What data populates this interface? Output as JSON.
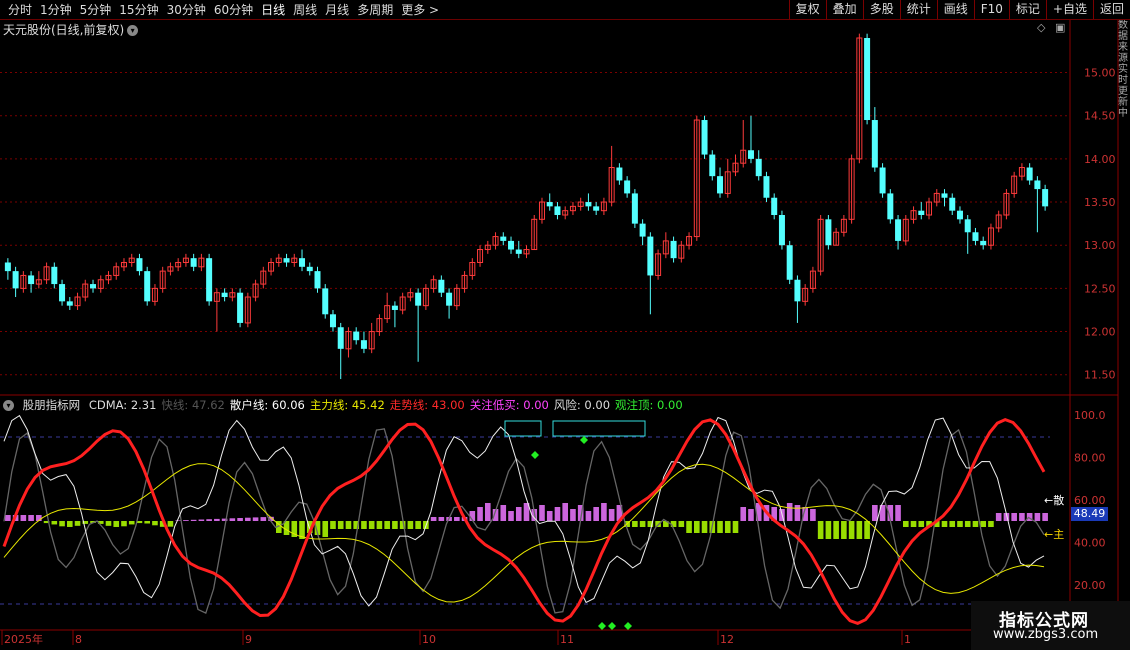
{
  "toolbar": {
    "periods": [
      "分时",
      "1分钟",
      "5分钟",
      "15分钟",
      "30分钟",
      "60分钟",
      "日线",
      "周线",
      "月线",
      "多周期",
      "更多 >"
    ],
    "active": "日线",
    "right": [
      "复权",
      "叠加",
      "多股",
      "统计",
      "画线",
      "F10",
      "标记",
      "+自选",
      "返回"
    ]
  },
  "chart_title": "天元股份(日线,前复权)",
  "chart_ctrl_icons": [
    "diamond-icon",
    "window-icon"
  ],
  "price_axis": {
    "ticks": [
      "15.00",
      "14.50",
      "14.00",
      "13.50",
      "13.00",
      "12.50",
      "12.00",
      "11.50"
    ]
  },
  "indicator": {
    "name": "股朋指标网",
    "items": [
      {
        "label": "CDMA: 2.31",
        "color": "#dddddd"
      },
      {
        "label": "快线: 47.62",
        "color": "#555555"
      },
      {
        "label": "散户线: 60.06",
        "color": "#ffffff"
      },
      {
        "label": "主力线: 45.42",
        "color": "#e8e800"
      },
      {
        "label": "走势线: 43.00",
        "color": "#ff2a2a"
      },
      {
        "label": "关注低买: 0.00",
        "color": "#ff44ff"
      },
      {
        "label": "风险: 0.00",
        "color": "#dddddd"
      },
      {
        "label": "观注顶: 0.00",
        "color": "#33ee33"
      }
    ],
    "ticks": [
      "100.0",
      "80.00",
      "60.00",
      "40.00",
      "20.00"
    ],
    "current_value": "48.49",
    "side_labels": [
      "←散",
      "←主"
    ]
  },
  "time_axis": {
    "labels": [
      "2025年",
      "8",
      "9",
      "10",
      "11",
      "12",
      "1"
    ]
  },
  "watermark": {
    "line1": "指标公式网",
    "line2": "www.zbgs3.com"
  },
  "right_strip": "数据来源实时更新中",
  "colors": {
    "up": "#ff3b3b",
    "down": "#54ffff",
    "grid": "#7a0000",
    "background": "#000000"
  },
  "chart_data": {
    "type": "candlestick",
    "ylim": [
      11.3,
      15.4
    ],
    "candles": [
      [
        12.8,
        12.7,
        12.85,
        12.6
      ],
      [
        12.7,
        12.5,
        12.75,
        12.4
      ],
      [
        12.5,
        12.65,
        12.7,
        12.45
      ],
      [
        12.65,
        12.55,
        12.7,
        12.45
      ],
      [
        12.55,
        12.6,
        12.7,
        12.5
      ],
      [
        12.6,
        12.75,
        12.8,
        12.55
      ],
      [
        12.75,
        12.55,
        12.8,
        12.5
      ],
      [
        12.55,
        12.35,
        12.6,
        12.3
      ],
      [
        12.35,
        12.3,
        12.4,
        12.25
      ],
      [
        12.3,
        12.4,
        12.45,
        12.25
      ],
      [
        12.4,
        12.55,
        12.6,
        12.35
      ],
      [
        12.55,
        12.5,
        12.6,
        12.45
      ],
      [
        12.5,
        12.6,
        12.65,
        12.45
      ],
      [
        12.6,
        12.65,
        12.7,
        12.55
      ],
      [
        12.65,
        12.75,
        12.8,
        12.6
      ],
      [
        12.75,
        12.8,
        12.85,
        12.7
      ],
      [
        12.8,
        12.85,
        12.9,
        12.75
      ],
      [
        12.85,
        12.7,
        12.9,
        12.65
      ],
      [
        12.7,
        12.35,
        12.75,
        12.3
      ],
      [
        12.35,
        12.5,
        12.55,
        12.3
      ],
      [
        12.5,
        12.7,
        12.75,
        12.45
      ],
      [
        12.7,
        12.75,
        12.8,
        12.65
      ],
      [
        12.75,
        12.8,
        12.85,
        12.7
      ],
      [
        12.8,
        12.85,
        12.9,
        12.75
      ],
      [
        12.85,
        12.75,
        12.9,
        12.7
      ],
      [
        12.75,
        12.85,
        12.9,
        12.7
      ],
      [
        12.85,
        12.35,
        12.9,
        12.3
      ],
      [
        12.35,
        12.45,
        12.5,
        12.0
      ],
      [
        12.45,
        12.4,
        12.5,
        12.35
      ],
      [
        12.4,
        12.45,
        12.5,
        12.35
      ],
      [
        12.45,
        12.1,
        12.5,
        12.05
      ],
      [
        12.1,
        12.4,
        12.45,
        12.05
      ],
      [
        12.4,
        12.55,
        12.6,
        12.35
      ],
      [
        12.55,
        12.7,
        12.75,
        12.5
      ],
      [
        12.7,
        12.8,
        12.85,
        12.65
      ],
      [
        12.8,
        12.85,
        12.9,
        12.75
      ],
      [
        12.85,
        12.8,
        12.9,
        12.75
      ],
      [
        12.8,
        12.85,
        12.9,
        12.75
      ],
      [
        12.85,
        12.75,
        12.95,
        12.7
      ],
      [
        12.75,
        12.7,
        12.8,
        12.65
      ],
      [
        12.7,
        12.5,
        12.75,
        12.45
      ],
      [
        12.5,
        12.2,
        12.55,
        12.15
      ],
      [
        12.2,
        12.05,
        12.25,
        12.0
      ],
      [
        12.05,
        11.8,
        12.1,
        11.45
      ],
      [
        11.8,
        12.0,
        12.05,
        11.7
      ],
      [
        12.0,
        11.9,
        12.05,
        11.85
      ],
      [
        11.9,
        11.8,
        12.0,
        11.75
      ],
      [
        11.8,
        12.0,
        12.1,
        11.75
      ],
      [
        12.0,
        12.15,
        12.2,
        11.95
      ],
      [
        12.15,
        12.3,
        12.45,
        12.1
      ],
      [
        12.3,
        12.25,
        12.35,
        12.05
      ],
      [
        12.25,
        12.4,
        12.45,
        12.2
      ],
      [
        12.4,
        12.45,
        12.5,
        12.35
      ],
      [
        12.45,
        12.3,
        12.5,
        11.65
      ],
      [
        12.3,
        12.5,
        12.55,
        12.25
      ],
      [
        12.5,
        12.6,
        12.65,
        12.45
      ],
      [
        12.6,
        12.45,
        12.65,
        12.4
      ],
      [
        12.45,
        12.3,
        12.5,
        12.15
      ],
      [
        12.3,
        12.5,
        12.55,
        12.25
      ],
      [
        12.5,
        12.65,
        12.7,
        12.45
      ],
      [
        12.65,
        12.8,
        12.85,
        12.6
      ],
      [
        12.8,
        12.95,
        13.0,
        12.75
      ],
      [
        12.95,
        13.0,
        13.05,
        12.9
      ],
      [
        13.0,
        13.1,
        13.15,
        12.95
      ],
      [
        13.1,
        13.05,
        13.15,
        13.0
      ],
      [
        13.05,
        12.95,
        13.1,
        12.9
      ],
      [
        12.95,
        12.9,
        13.05,
        12.85
      ],
      [
        12.9,
        12.95,
        13.0,
        12.85
      ],
      [
        12.95,
        13.3,
        13.35,
        12.95
      ],
      [
        13.3,
        13.5,
        13.55,
        13.25
      ],
      [
        13.5,
        13.45,
        13.6,
        13.4
      ],
      [
        13.45,
        13.35,
        13.5,
        13.3
      ],
      [
        13.35,
        13.4,
        13.45,
        13.3
      ],
      [
        13.4,
        13.45,
        13.5,
        13.35
      ],
      [
        13.45,
        13.5,
        13.55,
        13.4
      ],
      [
        13.5,
        13.45,
        13.6,
        13.4
      ],
      [
        13.45,
        13.4,
        13.5,
        13.35
      ],
      [
        13.4,
        13.5,
        13.55,
        13.35
      ],
      [
        13.5,
        13.9,
        14.15,
        13.45
      ],
      [
        13.9,
        13.75,
        13.95,
        13.7
      ],
      [
        13.75,
        13.6,
        13.8,
        13.55
      ],
      [
        13.6,
        13.25,
        13.65,
        13.2
      ],
      [
        13.25,
        13.1,
        13.3,
        13.0
      ],
      [
        13.1,
        12.65,
        13.15,
        12.2
      ],
      [
        12.65,
        12.9,
        12.95,
        12.6
      ],
      [
        12.9,
        13.05,
        13.15,
        12.85
      ],
      [
        13.05,
        12.85,
        13.1,
        12.8
      ],
      [
        12.85,
        13.0,
        13.05,
        12.8
      ],
      [
        13.0,
        13.1,
        13.15,
        12.95
      ],
      [
        13.1,
        14.45,
        14.5,
        13.05
      ],
      [
        14.45,
        14.05,
        14.5,
        14.0
      ],
      [
        14.05,
        13.8,
        14.1,
        13.75
      ],
      [
        13.8,
        13.6,
        13.9,
        13.55
      ],
      [
        13.6,
        13.85,
        14.0,
        13.55
      ],
      [
        13.85,
        13.95,
        14.05,
        13.8
      ],
      [
        13.95,
        14.1,
        14.45,
        13.9
      ],
      [
        14.1,
        14.0,
        14.5,
        13.95
      ],
      [
        14.0,
        13.8,
        14.1,
        13.75
      ],
      [
        13.8,
        13.55,
        13.85,
        13.5
      ],
      [
        13.55,
        13.35,
        13.6,
        13.3
      ],
      [
        13.35,
        13.0,
        13.4,
        12.95
      ],
      [
        13.0,
        12.6,
        13.05,
        12.55
      ],
      [
        12.6,
        12.35,
        12.65,
        12.1
      ],
      [
        12.35,
        12.5,
        12.55,
        12.3
      ],
      [
        12.5,
        12.7,
        12.75,
        12.45
      ],
      [
        12.7,
        13.3,
        13.35,
        12.65
      ],
      [
        13.3,
        13.0,
        13.35,
        12.95
      ],
      [
        13.0,
        13.15,
        13.2,
        13.0
      ],
      [
        13.15,
        13.3,
        13.35,
        13.1
      ],
      [
        13.3,
        14.0,
        14.05,
        13.25
      ],
      [
        14.0,
        15.4,
        15.45,
        13.95
      ],
      [
        15.4,
        14.45,
        15.45,
        14.4
      ],
      [
        14.45,
        13.9,
        14.6,
        13.85
      ],
      [
        13.9,
        13.6,
        13.95,
        13.55
      ],
      [
        13.6,
        13.3,
        13.65,
        13.25
      ],
      [
        13.3,
        13.05,
        13.35,
        12.95
      ],
      [
        13.05,
        13.3,
        13.35,
        13.0
      ],
      [
        13.3,
        13.4,
        13.45,
        13.25
      ],
      [
        13.4,
        13.35,
        13.5,
        13.3
      ],
      [
        13.35,
        13.5,
        13.55,
        13.3
      ],
      [
        13.5,
        13.6,
        13.65,
        13.45
      ],
      [
        13.6,
        13.55,
        13.65,
        13.45
      ],
      [
        13.55,
        13.4,
        13.6,
        13.35
      ],
      [
        13.4,
        13.3,
        13.45,
        13.25
      ],
      [
        13.3,
        13.15,
        13.35,
        12.9
      ],
      [
        13.15,
        13.05,
        13.2,
        13.0
      ],
      [
        13.05,
        13.0,
        13.1,
        12.95
      ],
      [
        13.0,
        13.2,
        13.25,
        12.95
      ],
      [
        13.2,
        13.35,
        13.4,
        13.15
      ],
      [
        13.35,
        13.6,
        13.65,
        13.3
      ],
      [
        13.6,
        13.8,
        13.85,
        13.55
      ],
      [
        13.8,
        13.9,
        13.95,
        13.75
      ],
      [
        13.9,
        13.75,
        13.95,
        13.7
      ],
      [
        13.75,
        13.65,
        13.8,
        13.15
      ],
      [
        13.65,
        13.45,
        13.7,
        13.4
      ]
    ]
  }
}
